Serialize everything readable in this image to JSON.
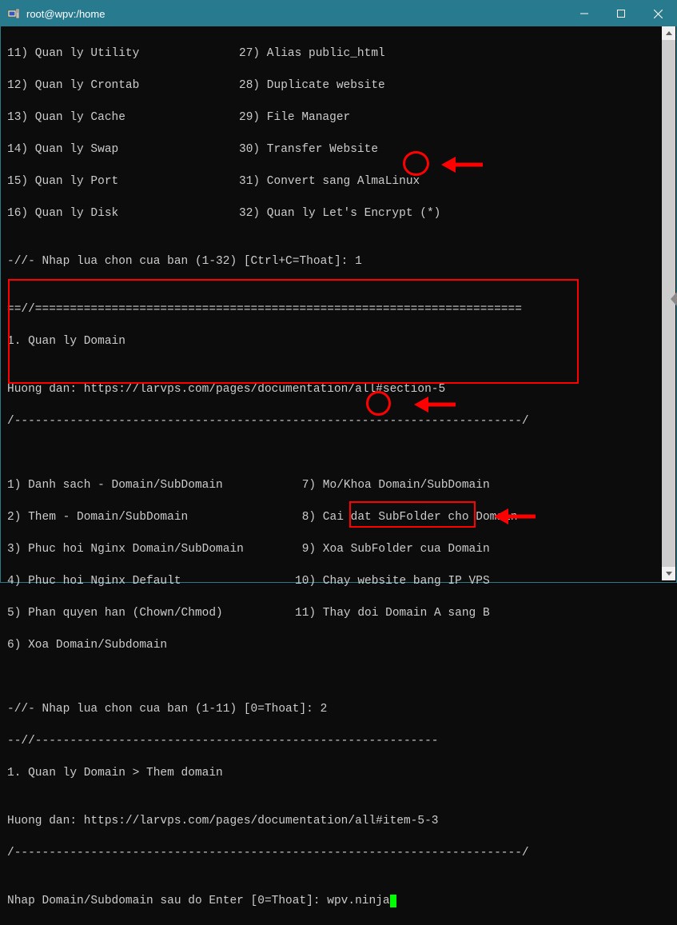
{
  "window": {
    "title": "root@wpv:/home"
  },
  "menu_top": [
    {
      "left": "11) Quan ly Utility",
      "right": "27) Alias public_html"
    },
    {
      "left": "12) Quan ly Crontab",
      "right": "28) Duplicate website"
    },
    {
      "left": "13) Quan ly Cache",
      "right": "29) File Manager"
    },
    {
      "left": "14) Quan ly Swap",
      "right": "30) Transfer Website"
    },
    {
      "left": "15) Quan ly Port",
      "right": "31) Convert sang AlmaLinux"
    },
    {
      "left": "16) Quan ly Disk",
      "right": "32) Quan ly Let's Encrypt (*)"
    }
  ],
  "prompt1_label": "-//- Nhap lua chon cua ban (1-32) [Ctrl+C=Thoat]: ",
  "prompt1_value": "1",
  "section1_title": "1. Quan ly Domain",
  "guide1_label": "Huong dan: https://larvps.com/pages/documentation/all#section-5",
  "sep_eq": "==//======================================================================",
  "sep_dash_slash": "/-------------------------------------------------------------------------/",
  "sep_dash": "--//----------------------------------------------------------",
  "submenu": [
    {
      "left": "1) Danh sach - Domain/SubDomain",
      "right": " 7) Mo/Khoa Domain/SubDomain"
    },
    {
      "left": "2) Them - Domain/SubDomain",
      "right": " 8) Cai dat SubFolder cho Domain"
    },
    {
      "left": "3) Phuc hoi Nginx Domain/SubDomain",
      "right": " 9) Xoa SubFolder cua Domain"
    },
    {
      "left": "4) Phuc hoi Nginx Default",
      "right": "10) Chay website bang IP VPS"
    },
    {
      "left": "5) Phan quyen han (Chown/Chmod)",
      "right": "11) Thay doi Domain A sang B"
    },
    {
      "left": "6) Xoa Domain/Subdomain",
      "right": ""
    }
  ],
  "prompt2_label": "-//- Nhap lua chon cua ban (1-11) [0=Thoat]: ",
  "prompt2_value": "2",
  "section2_title": "1. Quan ly Domain > Them domain",
  "guide2_label": "Huong dan: https://larvps.com/pages/documentation/all#item-5-3",
  "prompt3_label": "Nhap Domain/Subdomain sau do Enter [0=Thoat]: ",
  "prompt3_value": "wpv.ninja",
  "blank": "",
  "space": " "
}
